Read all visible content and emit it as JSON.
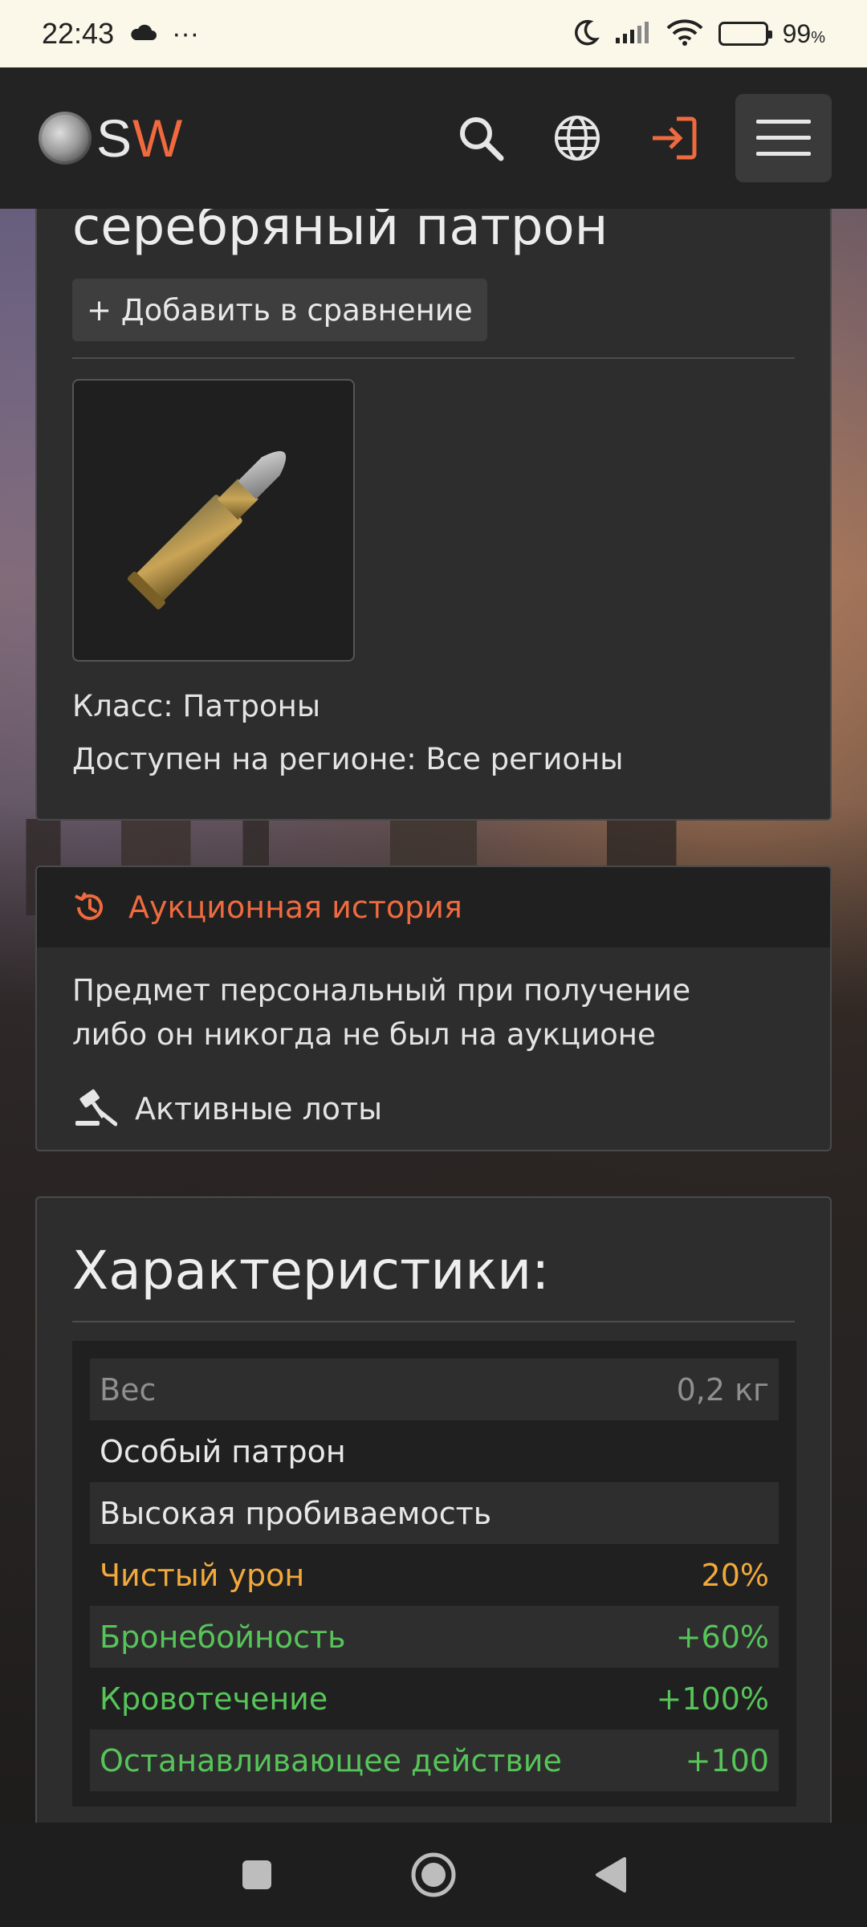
{
  "status_bar": {
    "time": "22:43",
    "more": "···",
    "battery": "99",
    "battery_unit": "%"
  },
  "header": {
    "logo_s": "S",
    "logo_w": "W"
  },
  "item": {
    "title": "серебряный патрон",
    "compare_label": "+ Добавить в сравнение",
    "class_line": "Класс: Патроны",
    "region_line": "Доступен на регионе: Все регионы"
  },
  "auction": {
    "title": "Аукционная история",
    "message_line1": "Предмет персональный при получение",
    "message_line2": "либо он никогда не был на аукционе",
    "active_lots": "Активные лоты"
  },
  "stats": {
    "title": "Характеристики:",
    "rows": [
      {
        "label": "Вес",
        "value": "0,2 кг"
      },
      {
        "label": "Особый патрон",
        "value": ""
      },
      {
        "label": "Высокая пробиваемость",
        "value": ""
      },
      {
        "label": "Чистый урон",
        "value": "20%"
      },
      {
        "label": "Бронебойность",
        "value": "+60%"
      },
      {
        "label": "Кровотечение",
        "value": "+100%"
      },
      {
        "label": "Останавливающее действие",
        "value": "+100"
      }
    ]
  },
  "colors": {
    "accent": "#ef6b3f",
    "damage": "#f2a93b",
    "bonus": "#57c45a",
    "muted": "#8f8f8f"
  }
}
